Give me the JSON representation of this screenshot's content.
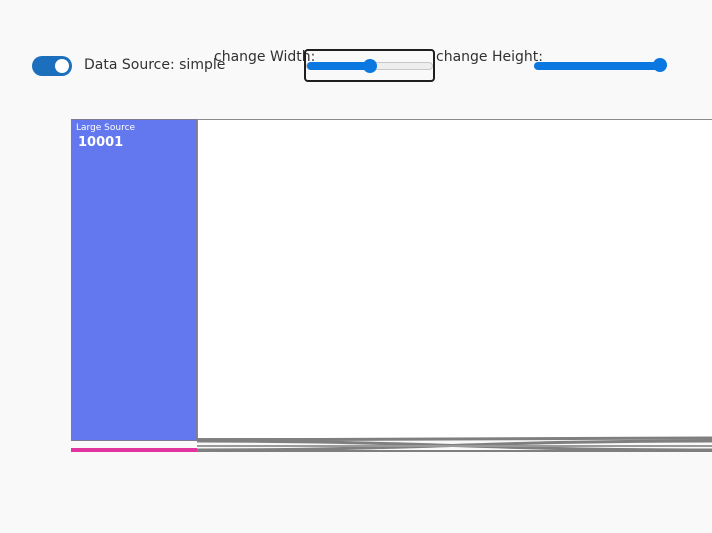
{
  "controls": {
    "toggle_label": "Data Source: simple",
    "toggle_on": true,
    "width_label": "change Width:",
    "width_value": 0.5,
    "height_label": "change Height:",
    "height_value": 1.0
  },
  "sankey": {
    "source_node": {
      "name": "Large Source",
      "value": "10001"
    },
    "colors": {
      "source": "#6378ee",
      "accent": "#e1349e",
      "link": "#7f7f7f",
      "slider": "#0a78e0"
    }
  }
}
